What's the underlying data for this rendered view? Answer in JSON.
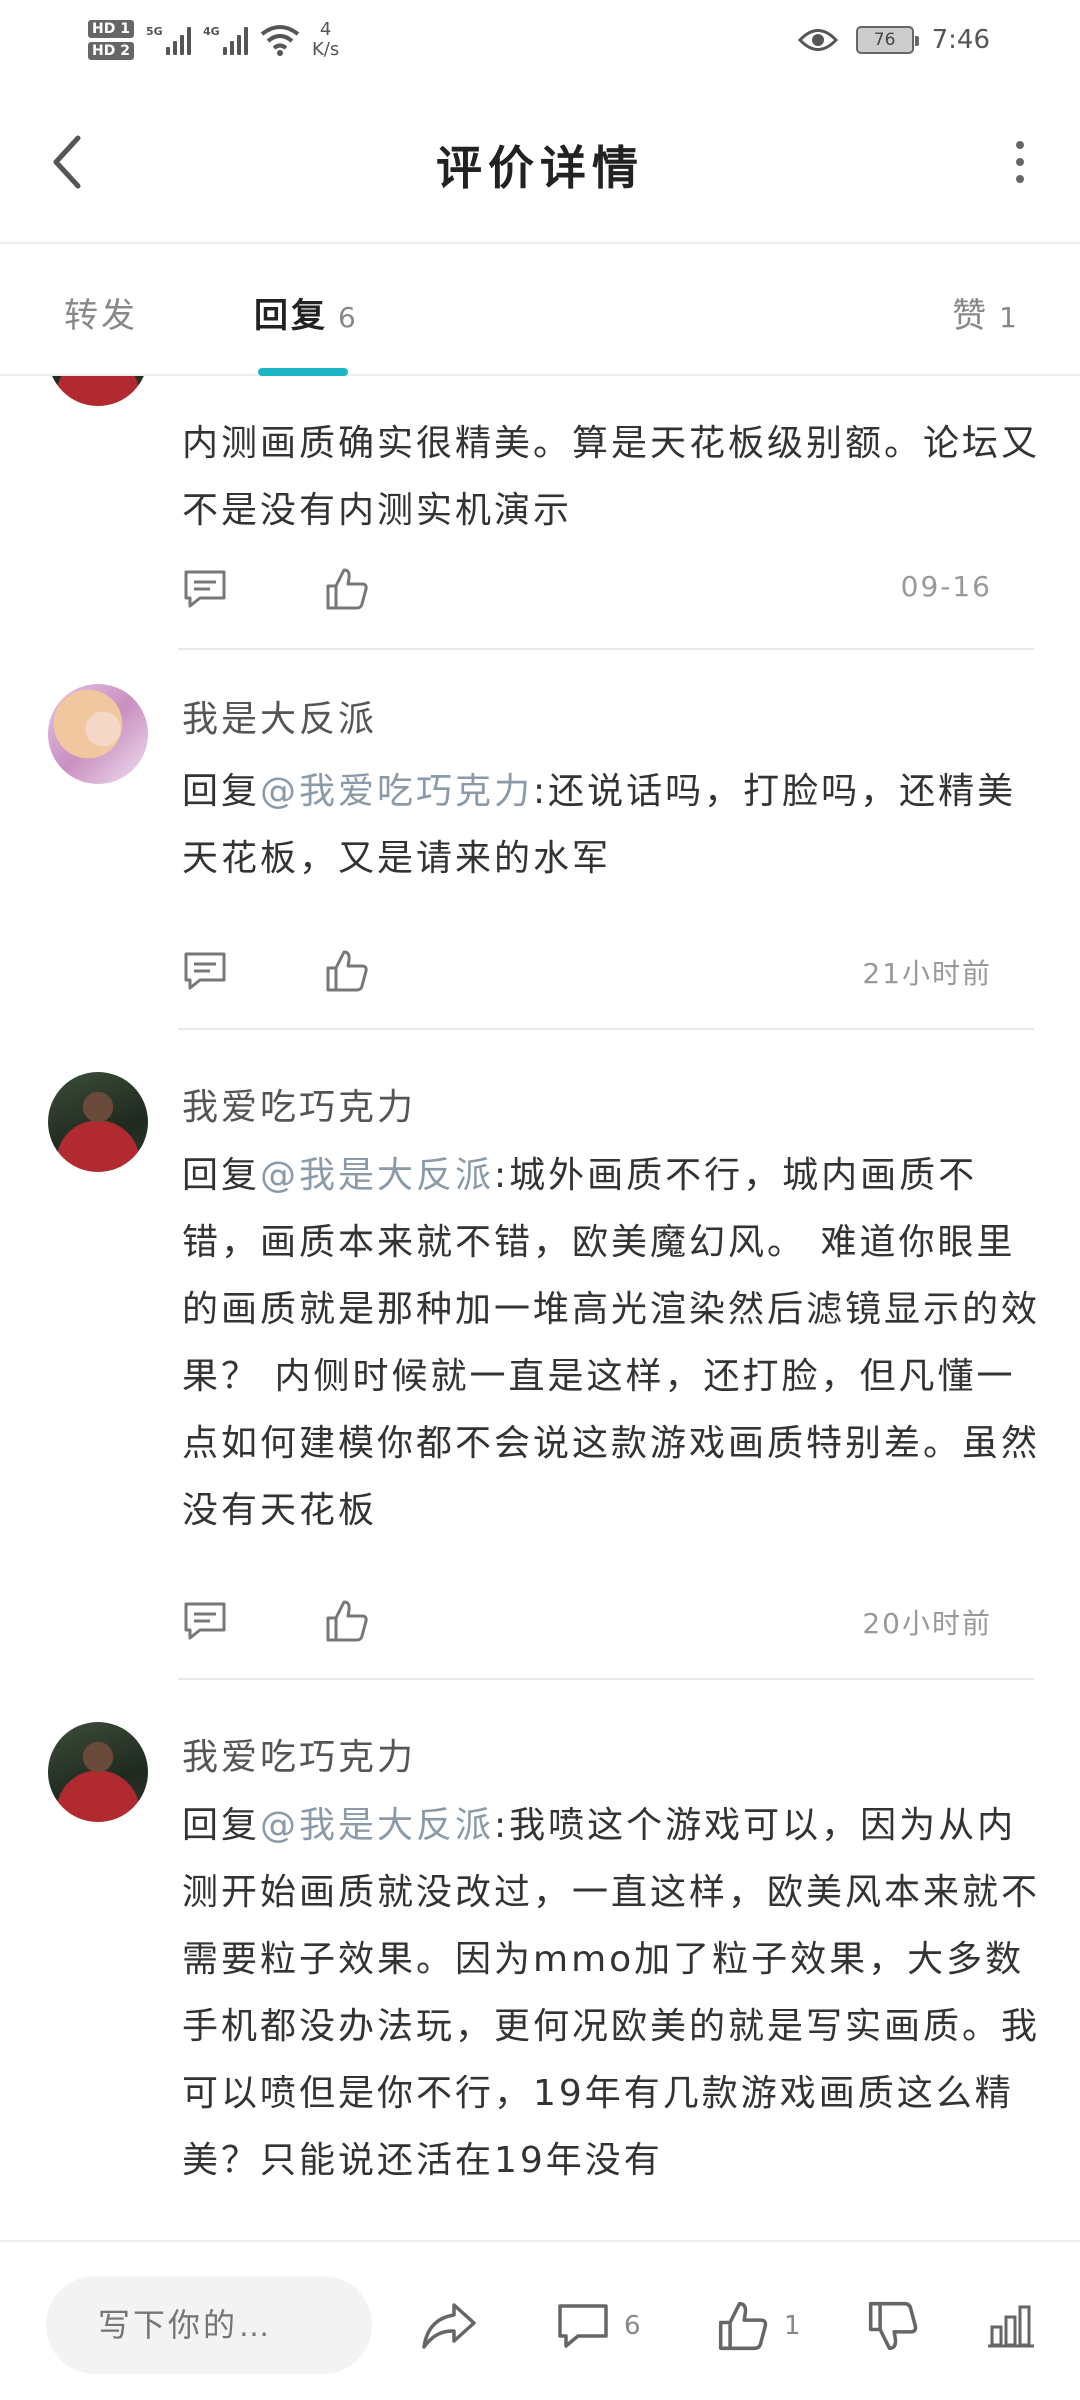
{
  "status_bar": {
    "hd1": "HD 1",
    "hd2": "HD 2",
    "sim1_label": "5G",
    "sim2_label": "4G",
    "speed_value": "4",
    "speed_unit": "K/s",
    "battery": "76",
    "time": "7:46"
  },
  "header": {
    "title": "评价详情"
  },
  "tabs": {
    "forward": "转发",
    "reply": "回复",
    "reply_count": "6",
    "like": "赞",
    "like_count": "1"
  },
  "comments": [
    {
      "username": "",
      "text": "内测画质确实很精美。算是天花板级别额。论坛又不是没有内测实机演示",
      "time": "09-16"
    },
    {
      "username": "我是大反派",
      "reply_prefix": "回复",
      "mention": "@我爱吃巧克力",
      "text": ":还说话吗，打脸吗，还精美天花板，又是请来的水军",
      "time": "21小时前"
    },
    {
      "username": "我爱吃巧克力",
      "reply_prefix": "回复",
      "mention": "@我是大反派",
      "text": ":城外画质不行，城内画质不错，画质本来就不错，欧美魔幻风。 难道你眼里的画质就是那种加一堆高光渲染然后滤镜显示的效果？ 内侧时候就一直是这样，还打脸，但凡懂一点如何建模你都不会说这款游戏画质特别差。虽然没有天花板",
      "time": "20小时前"
    },
    {
      "username": "我爱吃巧克力",
      "reply_prefix": "回复",
      "mention": "@我是大反派",
      "text": ":我喷这个游戏可以，因为从内测开始画质就没改过，一直这样，欧美风本来就不需要粒子效果。因为mmo加了粒子效果，大多数手机都没办法玩，更何况欧美的就是写实画质。我可以喷但是你不行，19年有几款游戏画质这么精美？只能说还活在19年没有",
      "time": ""
    }
  ],
  "bottom_bar": {
    "input_placeholder": "写下你的…",
    "comment_count": "6",
    "like_count": "1"
  },
  "colors": {
    "accent": "#1eb6c4",
    "mention": "#8a9aa8",
    "text": "#333333",
    "muted": "#999999"
  }
}
